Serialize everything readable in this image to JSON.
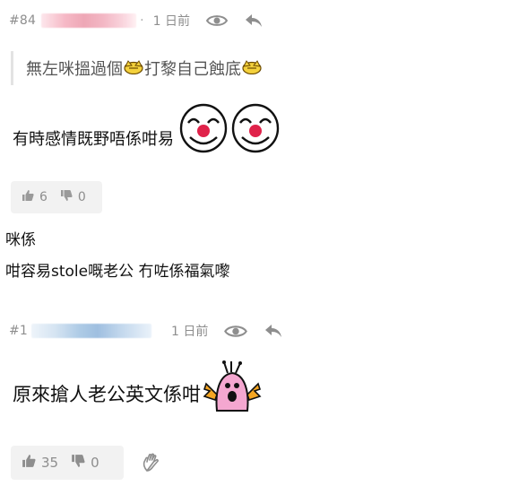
{
  "post1": {
    "number": "#84",
    "separator": "·",
    "timestamp": "1 日前",
    "icons": {
      "view": "eye-icon",
      "reply": "reply-icon"
    },
    "quote": {
      "text_before": "無左咪搵過個",
      "text_middle": "打黎自己蝕底"
    },
    "content": "有時感情既野唔係咁易",
    "votes": {
      "up": "6",
      "down": "0"
    }
  },
  "text_lines": [
    "咪係",
    "咁容易stole嘅老公 冇咗係福氣嚟"
  ],
  "post2": {
    "number": "#1",
    "timestamp": "1 日前",
    "icons": {
      "view": "eye-icon",
      "reply": "reply-icon",
      "wave": "waving-hand-icon"
    },
    "content": "原來搶人老公英文係咁",
    "votes": {
      "up": "35",
      "down": "0"
    }
  },
  "colors": {
    "meta_gray": "#8e8e8e",
    "vote_bg": "#f2f2f2",
    "quote_border": "#e3e3e3"
  }
}
